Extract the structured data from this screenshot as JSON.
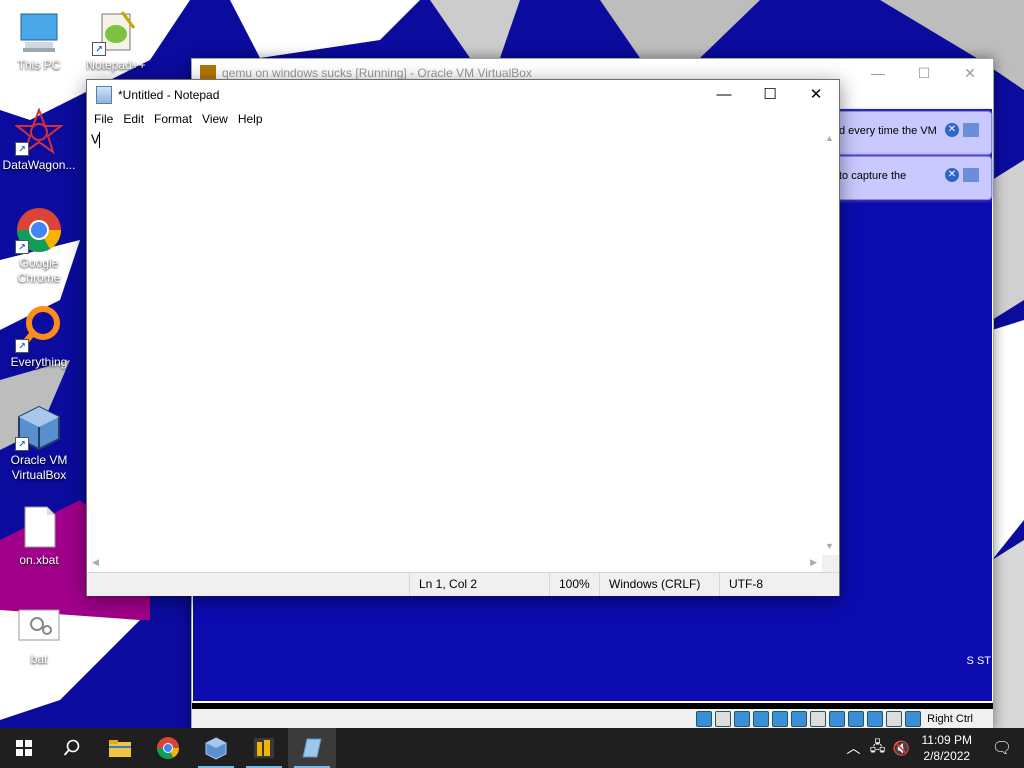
{
  "desktop": {
    "icons": [
      {
        "label": "This PC"
      },
      {
        "label": "Notepad++"
      },
      {
        "label": "DataWagon..."
      },
      {
        "label": "Google Chrome"
      },
      {
        "label": "Everything"
      },
      {
        "label": "Oracle VM VirtualBox"
      },
      {
        "label": "on.xbat"
      },
      {
        "label": "bat"
      }
    ]
  },
  "vbox": {
    "title": "qemu on windows sucks [Running] - Oracle VM VirtualBox",
    "notice1": "d every time the VM",
    "notice2": "to capture the",
    "host_key": "Right Ctrl",
    "side_text": "S ST"
  },
  "notepad": {
    "title": "*Untitled - Notepad",
    "menu": [
      "File",
      "Edit",
      "Format",
      "View",
      "Help"
    ],
    "content": "V",
    "status": {
      "position": "Ln 1, Col 2",
      "zoom": "100%",
      "line_ending": "Windows (CRLF)",
      "encoding": "UTF-8"
    }
  },
  "taskbar": {
    "time": "11:09 PM",
    "date": "2/8/2022"
  },
  "colors": {
    "wallpaper_blue": "#0b0b9e",
    "taskbar": "#1f1f1f",
    "accent": "#76b9ed"
  }
}
